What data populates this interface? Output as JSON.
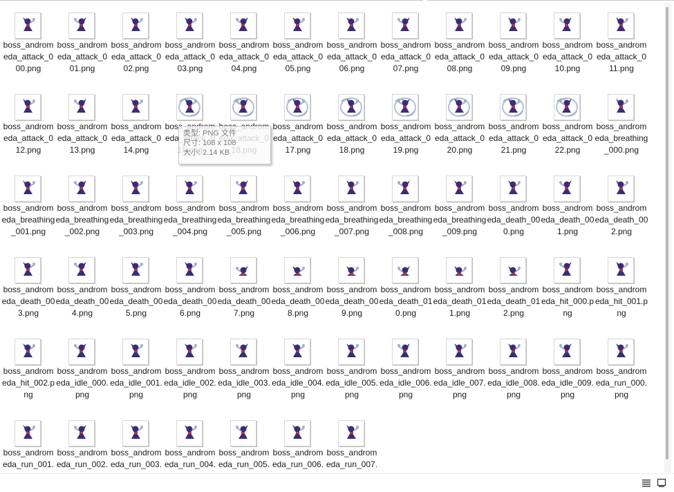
{
  "files": [
    "boss_andromeda_attack_000.png",
    "boss_andromeda_attack_001.png",
    "boss_andromeda_attack_002.png",
    "boss_andromeda_attack_003.png",
    "boss_andromeda_attack_004.png",
    "boss_andromeda_attack_005.png",
    "boss_andromeda_attack_006.png",
    "boss_andromeda_attack_007.png",
    "boss_andromeda_attack_008.png",
    "boss_andromeda_attack_009.png",
    "boss_andromeda_attack_010.png",
    "boss_andromeda_attack_011.png",
    "boss_andromeda_attack_012.png",
    "boss_andromeda_attack_013.png",
    "boss_andromeda_attack_014.png",
    "boss_andromeda_attack_015.png",
    "boss_andromeda_attack_016.png",
    "boss_andromeda_attack_017.png",
    "boss_andromeda_attack_018.png",
    "boss_andromeda_attack_019.png",
    "boss_andromeda_attack_020.png",
    "boss_andromeda_attack_021.png",
    "boss_andromeda_attack_022.png",
    "boss_andromeda_breathing_000.png",
    "boss_andromeda_breathing_001.png",
    "boss_andromeda_breathing_002.png",
    "boss_andromeda_breathing_003.png",
    "boss_andromeda_breathing_004.png",
    "boss_andromeda_breathing_005.png",
    "boss_andromeda_breathing_006.png",
    "boss_andromeda_breathing_007.png",
    "boss_andromeda_breathing_008.png",
    "boss_andromeda_breathing_009.png",
    "boss_andromeda_death_000.png",
    "boss_andromeda_death_001.png",
    "boss_andromeda_death_002.png",
    "boss_andromeda_death_003.png",
    "boss_andromeda_death_004.png",
    "boss_andromeda_death_005.png",
    "boss_andromeda_death_006.png",
    "boss_andromeda_death_007.png",
    "boss_andromeda_death_008.png",
    "boss_andromeda_death_009.png",
    "boss_andromeda_death_010.png",
    "boss_andromeda_death_011.png",
    "boss_andromeda_death_012.png",
    "boss_andromeda_hit_000.png",
    "boss_andromeda_hit_001.png",
    "boss_andromeda_hit_002.png",
    "boss_andromeda_idle_000.png",
    "boss_andromeda_idle_001.png",
    "boss_andromeda_idle_002.png",
    "boss_andromeda_idle_003.png",
    "boss_andromeda_idle_004.png",
    "boss_andromeda_idle_005.png",
    "boss_andromeda_idle_006.png",
    "boss_andromeda_idle_007.png",
    "boss_andromeda_idle_008.png",
    "boss_andromeda_idle_009.png",
    "boss_andromeda_run_000.png",
    "boss_andromeda_run_001.png",
    "boss_andromeda_run_002.png",
    "boss_andromeda_run_003.png",
    "boss_andromeda_run_004.png",
    "boss_andromeda_run_005.png",
    "boss_andromeda_run_006.png",
    "boss_andromeda_run_007.png"
  ],
  "tooltip": {
    "line1": "类型: PNG 文件",
    "line2": "尺寸: 108 x 108",
    "line3": "大小: 2.14 KB"
  },
  "thumbnail_icon": "sprite-thumbnail-icon",
  "statusbar": {
    "details_view_icon": "details-view-icon",
    "large_icons_view_icon": "large-icons-view-icon"
  },
  "colors": {
    "sprite_purple": "#3b2c78",
    "sprite_red": "#b8324a",
    "sprite_pale": "#9fb0c8"
  }
}
